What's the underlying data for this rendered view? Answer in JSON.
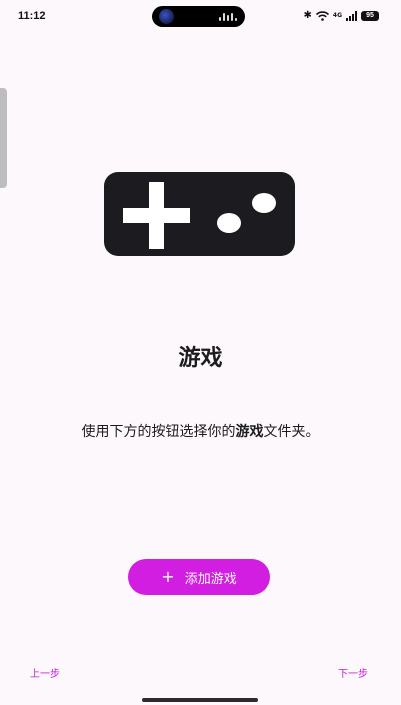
{
  "status_bar": {
    "time": "11:12",
    "bluetooth_icon": "bluetooth-icon",
    "wifi_icon": "wifi-icon",
    "network_type": "4G",
    "battery": "95"
  },
  "hero": {
    "icon": "gamepad-icon"
  },
  "title": "游戏",
  "description": {
    "before": "使用下方的按钮选择你的",
    "emphasis": "游戏",
    "after": "文件夹。"
  },
  "add_button": {
    "icon": "plus-icon",
    "label": "添加游戏"
  },
  "navigation": {
    "prev_label": "上一步",
    "next_label": "下一步"
  },
  "colors": {
    "accent": "#d21ee0",
    "link": "#c41ad2",
    "background": "#fcf8fc",
    "icon_dark": "#1c1b1f"
  }
}
